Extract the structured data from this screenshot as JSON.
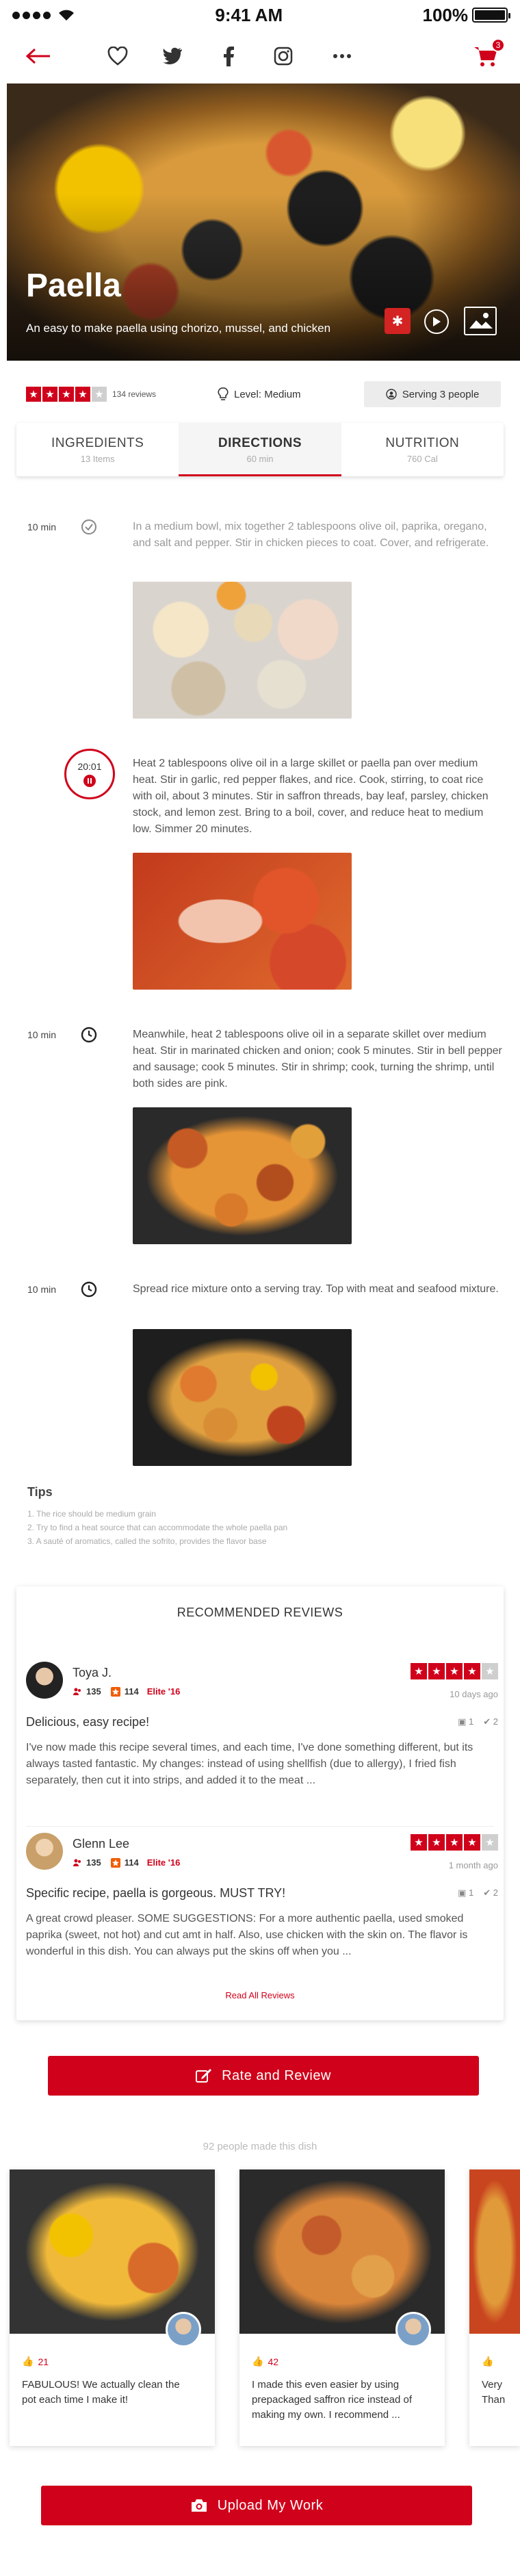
{
  "status_bar": {
    "time": "9:41 AM",
    "battery": "100%"
  },
  "nav": {
    "cart_count": "3"
  },
  "hero": {
    "title": "Paella",
    "subtitle": "An easy to make paella using chorizo, mussel, and chicken",
    "badge": "✱"
  },
  "rating": {
    "stars": 4,
    "reviews": "134 reviews",
    "level": "Level: Medium",
    "serving": "Serving 3 people"
  },
  "tabs": [
    {
      "label": "INGREDIENTS",
      "sub": "13 Items"
    },
    {
      "label": "DIRECTIONS",
      "sub": "60 min"
    },
    {
      "label": "NUTRITION",
      "sub": "760 Cal"
    }
  ],
  "steps": [
    {
      "time": "10 min",
      "text": "In a medium bowl, mix together 2 tablespoons olive oil, paprika, oregano, and salt and pepper. Stir in chicken pieces to coat. Cover, and refrigerate."
    },
    {
      "timer": "20:01",
      "text": "Heat 2 tablespoons olive oil in a large skillet or paella pan over medium heat. Stir in garlic, red pepper flakes, and rice. Cook, stirring, to coat rice with oil, about 3 minutes. Stir in saffron threads, bay leaf, parsley, chicken stock, and lemon zest. Bring to a boil, cover, and reduce heat to medium low. Simmer 20 minutes."
    },
    {
      "time": "10 min",
      "text": "Meanwhile, heat 2 tablespoons olive oil in a separate skillet over medium heat. Stir in marinated chicken and onion; cook 5 minutes. Stir in bell pepper and sausage; cook 5 minutes. Stir in shrimp; cook, turning the shrimp, until both sides are pink."
    },
    {
      "time": "10 min",
      "text": "Spread rice mixture onto a serving tray. Top with meat and seafood mixture."
    }
  ],
  "tips": {
    "title": "Tips",
    "items": [
      "1. The rice should be medium grain",
      "2. Try to find a heat source that can accommodate the whole paella pan",
      "3. A sauté of aromatics, called the sofrito, provides the flavor base"
    ]
  },
  "reviews": {
    "title": "RECOMMENDED REVIEWS",
    "items": [
      {
        "name": "Toya J.",
        "friends": "135",
        "reviews": "114",
        "elite": "Elite '16",
        "stars": 4,
        "date": "10 days ago",
        "headline": "Delicious, easy recipe!",
        "photos": "1",
        "checkins": "2",
        "body": "I've now made this recipe several times, and each time, I've done something different, but its always tasted fantastic. My changes: instead of using shellfish (due to allergy), I fried fish separately, then cut it into strips, and added it to the meat ..."
      },
      {
        "name": "Glenn Lee",
        "friends": "135",
        "reviews": "114",
        "elite": "Elite '16",
        "stars": 4,
        "date": "1 month ago",
        "headline": "Specific recipe, paella is gorgeous. MUST TRY!",
        "photos": "1",
        "checkins": "2",
        "body": "A great crowd pleaser. SOME SUGGESTIONS: For a more authentic paella, used smoked paprika (sweet, not hot) and cut amt in half. Also, use chicken with the skin on. The flavor is wonderful in this dish. You can always put the skins off when you ..."
      }
    ],
    "read_all": "Read All Reviews"
  },
  "rate_button": "Rate and Review",
  "made_this": "92 people made this dish",
  "user_posts": [
    {
      "likes": "21",
      "text": "FABULOUS! We actually clean the pot each time I make it!"
    },
    {
      "likes": "42",
      "text": "I made this even easier by using prepackaged saffron rice instead of making my own. I recommend ..."
    },
    {
      "likes": "",
      "text": "Very Than"
    }
  ],
  "upload_button": "Upload My Work",
  "colors": {
    "accent": "#d0021b"
  }
}
